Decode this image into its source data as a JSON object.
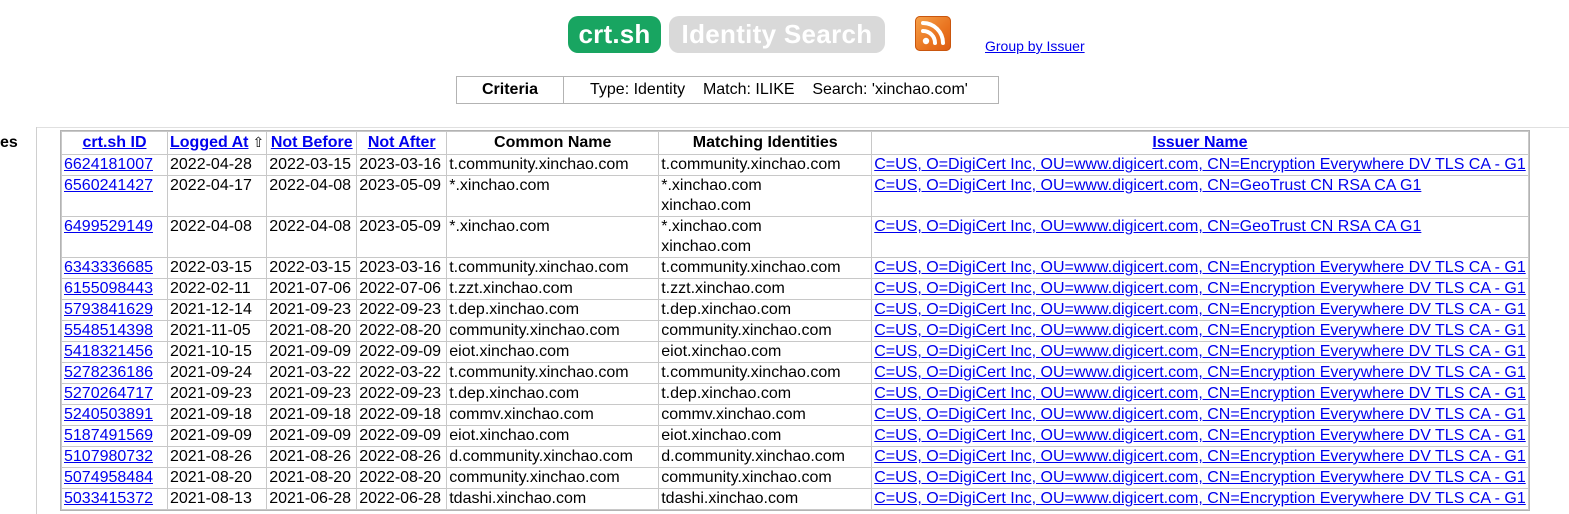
{
  "header": {
    "brand": "crt.sh",
    "subtitle": "Identity Search",
    "rss_icon": "rss-feed-icon",
    "group_by_issuer": "Group by Issuer",
    "brand_color": "#18a561"
  },
  "criteria": {
    "label": "Criteria",
    "text": "Type: Identity    Match: ILIKE    Search: 'xinchao.com'"
  },
  "left_label": "es",
  "table": {
    "headers": {
      "id": "crt.sh ID",
      "logged_at": "Logged At",
      "sort_arrow": "⇧",
      "not_before": "Not Before",
      "not_after": "Not After",
      "common_name": "Common Name",
      "matching": "Matching Identities",
      "issuer": "Issuer Name"
    },
    "rows": [
      {
        "id": "6624181007",
        "logged": "2022-04-28",
        "nb": "2022-03-15",
        "na": "2023-03-16",
        "cn": "t.community.xinchao.com",
        "mi": [
          "t.community.xinchao.com"
        ],
        "issuer": "C=US, O=DigiCert Inc, OU=www.digicert.com, CN=Encryption Everywhere DV TLS CA - G1"
      },
      {
        "id": "6560241427",
        "logged": "2022-04-17",
        "nb": "2022-04-08",
        "na": "2023-05-09",
        "cn": "*.xinchao.com",
        "mi": [
          "*.xinchao.com",
          "xinchao.com"
        ],
        "issuer": "C=US, O=DigiCert Inc, OU=www.digicert.com, CN=GeoTrust CN RSA CA G1"
      },
      {
        "id": "6499529149",
        "logged": "2022-04-08",
        "nb": "2022-04-08",
        "na": "2023-05-09",
        "cn": "*.xinchao.com",
        "mi": [
          "*.xinchao.com",
          "xinchao.com"
        ],
        "issuer": "C=US, O=DigiCert Inc, OU=www.digicert.com, CN=GeoTrust CN RSA CA G1"
      },
      {
        "id": "6343336685",
        "logged": "2022-03-15",
        "nb": "2022-03-15",
        "na": "2023-03-16",
        "cn": "t.community.xinchao.com",
        "mi": [
          "t.community.xinchao.com"
        ],
        "issuer": "C=US, O=DigiCert Inc, OU=www.digicert.com, CN=Encryption Everywhere DV TLS CA - G1"
      },
      {
        "id": "6155098443",
        "logged": "2022-02-11",
        "nb": "2021-07-06",
        "na": "2022-07-06",
        "cn": "t.zzt.xinchao.com",
        "mi": [
          "t.zzt.xinchao.com"
        ],
        "issuer": "C=US, O=DigiCert Inc, OU=www.digicert.com, CN=Encryption Everywhere DV TLS CA - G1"
      },
      {
        "id": "5793841629",
        "logged": "2021-12-14",
        "nb": "2021-09-23",
        "na": "2022-09-23",
        "cn": "t.dep.xinchao.com",
        "mi": [
          "t.dep.xinchao.com"
        ],
        "issuer": "C=US, O=DigiCert Inc, OU=www.digicert.com, CN=Encryption Everywhere DV TLS CA - G1"
      },
      {
        "id": "5548514398",
        "logged": "2021-11-05",
        "nb": "2021-08-20",
        "na": "2022-08-20",
        "cn": "community.xinchao.com",
        "mi": [
          "community.xinchao.com"
        ],
        "issuer": "C=US, O=DigiCert Inc, OU=www.digicert.com, CN=Encryption Everywhere DV TLS CA - G1"
      },
      {
        "id": "5418321456",
        "logged": "2021-10-15",
        "nb": "2021-09-09",
        "na": "2022-09-09",
        "cn": "eiot.xinchao.com",
        "mi": [
          "eiot.xinchao.com"
        ],
        "issuer": "C=US, O=DigiCert Inc, OU=www.digicert.com, CN=Encryption Everywhere DV TLS CA - G1"
      },
      {
        "id": "5278236186",
        "logged": "2021-09-24",
        "nb": "2021-03-22",
        "na": "2022-03-22",
        "cn": "t.community.xinchao.com",
        "mi": [
          "t.community.xinchao.com"
        ],
        "issuer": "C=US, O=DigiCert Inc, OU=www.digicert.com, CN=Encryption Everywhere DV TLS CA - G1"
      },
      {
        "id": "5270264717",
        "logged": "2021-09-23",
        "nb": "2021-09-23",
        "na": "2022-09-23",
        "cn": "t.dep.xinchao.com",
        "mi": [
          "t.dep.xinchao.com"
        ],
        "issuer": "C=US, O=DigiCert Inc, OU=www.digicert.com, CN=Encryption Everywhere DV TLS CA - G1"
      },
      {
        "id": "5240503891",
        "logged": "2021-09-18",
        "nb": "2021-09-18",
        "na": "2022-09-18",
        "cn": "commv.xinchao.com",
        "mi": [
          "commv.xinchao.com"
        ],
        "issuer": "C=US, O=DigiCert Inc, OU=www.digicert.com, CN=Encryption Everywhere DV TLS CA - G1"
      },
      {
        "id": "5187491569",
        "logged": "2021-09-09",
        "nb": "2021-09-09",
        "na": "2022-09-09",
        "cn": "eiot.xinchao.com",
        "mi": [
          "eiot.xinchao.com"
        ],
        "issuer": "C=US, O=DigiCert Inc, OU=www.digicert.com, CN=Encryption Everywhere DV TLS CA - G1"
      },
      {
        "id": "5107980732",
        "logged": "2021-08-26",
        "nb": "2021-08-26",
        "na": "2022-08-26",
        "cn": "d.community.xinchao.com",
        "mi": [
          "d.community.xinchao.com"
        ],
        "issuer": "C=US, O=DigiCert Inc, OU=www.digicert.com, CN=Encryption Everywhere DV TLS CA - G1"
      },
      {
        "id": "5074958484",
        "logged": "2021-08-20",
        "nb": "2021-08-20",
        "na": "2022-08-20",
        "cn": "community.xinchao.com",
        "mi": [
          "community.xinchao.com"
        ],
        "issuer": "C=US, O=DigiCert Inc, OU=www.digicert.com, CN=Encryption Everywhere DV TLS CA - G1"
      },
      {
        "id": "5033415372",
        "logged": "2021-08-13",
        "nb": "2021-06-28",
        "na": "2022-06-28",
        "cn": "tdashi.xinchao.com",
        "mi": [
          "tdashi.xinchao.com"
        ],
        "issuer": "C=US, O=DigiCert Inc, OU=www.digicert.com, CN=Encryption Everywhere DV TLS CA - G1"
      }
    ]
  }
}
